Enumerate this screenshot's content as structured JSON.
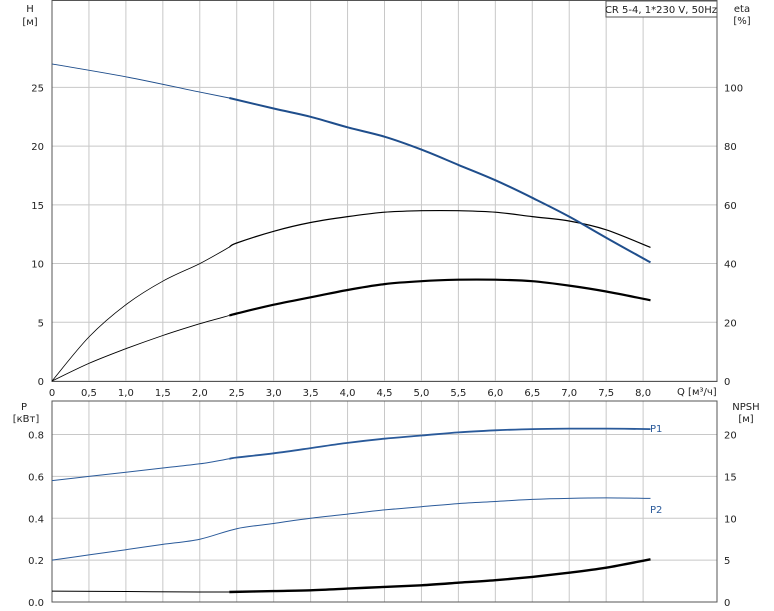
{
  "title": "CR 5-4, 1*230 V, 50Hz",
  "top": {
    "left_axis_label": "H",
    "left_axis_unit": "[м]",
    "right_axis_label": "eta",
    "right_axis_unit": "[%]",
    "x_axis_label": "Q [м³/ч]",
    "x_ticks": [
      "0",
      "0,5",
      "1,0",
      "1,5",
      "2,0",
      "2,5",
      "3,0",
      "3,5",
      "4,0",
      "4,5",
      "5,0",
      "5,5",
      "6,0",
      "6,5",
      "7,0",
      "7,5",
      "8,0"
    ],
    "left_ticks": [
      "0",
      "5",
      "10",
      "15",
      "20",
      "25"
    ],
    "right_ticks": [
      "0",
      "20",
      "40",
      "60",
      "80",
      "100"
    ]
  },
  "bottom": {
    "left_axis_label": "P",
    "left_axis_unit": "[кВт]",
    "right_axis_label": "NPSH",
    "right_axis_unit": "[м]",
    "left_ticks": [
      "0.0",
      "0.2",
      "0.4",
      "0.6",
      "0.8"
    ],
    "right_ticks": [
      "0",
      "5",
      "10",
      "15",
      "20"
    ],
    "p1_label": "P1",
    "p2_label": "P2"
  },
  "colors": {
    "head_curve": "#1f4e8c",
    "power_curve": "#2a5a9a",
    "efficiency_curve": "#000000",
    "npsh_curve": "#000000",
    "grid": "#c8c8c8"
  },
  "chart_data": [
    {
      "type": "line",
      "title": "CR 5-4, 1*230 V, 50Hz",
      "xlabel": "Q [м³/ч]",
      "ylabel": "H [м]",
      "y2label": "eta [%]",
      "xlim": [
        0,
        9
      ],
      "ylim": [
        0,
        32.4
      ],
      "y2lim": [
        0,
        129.6
      ],
      "grid": true,
      "series": [
        {
          "axis": "left",
          "x": [
            0,
            1.0,
            2.0,
            2.4,
            3.0,
            3.5,
            4.0,
            4.5,
            5.0,
            5.5,
            6.0,
            6.5,
            7.0,
            7.5,
            8.1
          ],
          "values": [
            27.0,
            25.9,
            24.6,
            24.1,
            23.2,
            22.5,
            21.6,
            20.8,
            19.7,
            18.4,
            17.1,
            15.6,
            14.0,
            12.2,
            10.1
          ]
        },
        {
          "axis": "right",
          "x": [
            0,
            0.5,
            1.0,
            1.5,
            2.0,
            2.5,
            3.0,
            3.5,
            4.0,
            4.5,
            5.0,
            5.5,
            6.0,
            6.5,
            7.0,
            7.5,
            8.1
          ],
          "values": [
            0,
            15,
            26,
            34,
            40,
            47,
            51,
            54,
            56,
            57.5,
            58,
            58,
            57.5,
            56,
            54.5,
            51.5,
            45.5
          ]
        },
        {
          "axis": "right",
          "x": [
            0,
            0.5,
            1.0,
            1.5,
            2.0,
            2.5,
            3.0,
            3.5,
            4.0,
            4.5,
            5.0,
            5.5,
            6.0,
            6.5,
            7.0,
            7.5,
            8.1
          ],
          "values": [
            0,
            6,
            11,
            15.5,
            19.5,
            23,
            26,
            28.5,
            31,
            33,
            34,
            34.5,
            34.5,
            34,
            32.5,
            30.5,
            27.5
          ]
        }
      ]
    },
    {
      "type": "line",
      "xlabel": "Q [м³/ч]",
      "ylabel": "P [кВт]",
      "y2label": "NPSH [м]",
      "xlim": [
        0,
        9
      ],
      "ylim": [
        0,
        0.96
      ],
      "y2lim": [
        0,
        24
      ],
      "grid": true,
      "series": [
        {
          "name": "P1",
          "axis": "left",
          "x": [
            0,
            0.5,
            1.0,
            1.5,
            2.0,
            2.5,
            3.0,
            3.5,
            4.0,
            4.5,
            5.0,
            5.5,
            6.0,
            6.5,
            7.0,
            7.5,
            8.1
          ],
          "values": [
            0.58,
            0.6,
            0.62,
            0.64,
            0.66,
            0.69,
            0.71,
            0.735,
            0.76,
            0.78,
            0.795,
            0.81,
            0.82,
            0.826,
            0.828,
            0.828,
            0.826
          ]
        },
        {
          "name": "P2",
          "axis": "left",
          "x": [
            0,
            0.5,
            1.0,
            1.5,
            2.0,
            2.5,
            3.0,
            3.5,
            4.0,
            4.5,
            5.0,
            5.5,
            6.0,
            6.5,
            7.0,
            7.5,
            8.1
          ],
          "values": [
            0.2,
            0.225,
            0.25,
            0.275,
            0.3,
            0.35,
            0.375,
            0.4,
            0.42,
            0.44,
            0.455,
            0.47,
            0.48,
            0.49,
            0.495,
            0.497,
            0.495
          ]
        },
        {
          "axis": "right",
          "x": [
            0,
            1.0,
            2.0,
            2.4,
            3.0,
            3.5,
            4.0,
            4.5,
            5.0,
            5.5,
            6.0,
            6.5,
            7.0,
            7.5,
            8.1
          ],
          "values": [
            1.3,
            1.25,
            1.2,
            1.2,
            1.3,
            1.4,
            1.6,
            1.8,
            2.0,
            2.3,
            2.6,
            3.0,
            3.5,
            4.1,
            5.1
          ]
        }
      ]
    }
  ]
}
